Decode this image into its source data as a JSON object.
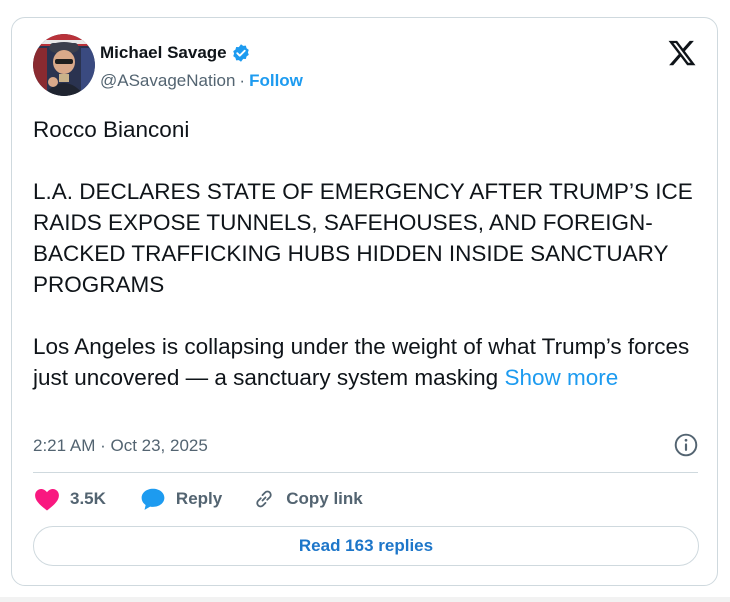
{
  "author": {
    "name": "Michael Savage",
    "handle": "@ASavageNation",
    "separator": "·",
    "follow_label": "Follow"
  },
  "tweet": {
    "body": "Rocco Bianconi\n\nL.A. DECLARES STATE OF EMERGENCY AFTER TRUMP’S ICE RAIDS EXPOSE TUNNELS, SAFEHOUSES, AND FOREIGN-BACKED TRAFFICKING HUBS HIDDEN INSIDE SANCTUARY PROGRAMS\n\nLos Angeles is collapsing under the weight of what Trump’s forces just uncovered — a sanctuary system masking ",
    "show_more_label": "Show more",
    "timestamp": "2:21 AM · Oct 23, 2025"
  },
  "actions": {
    "like_count": "3.5K",
    "reply_label": "Reply",
    "copy_link_label": "Copy link"
  },
  "read_replies_label": "Read 163 replies",
  "colors": {
    "accent": "#1d9bf0",
    "like": "#f91880",
    "verified": "#1d9bf0",
    "muted": "#536471"
  },
  "icons": {
    "verified": "verified-badge-icon",
    "brand": "x-logo-icon",
    "info": "info-icon",
    "like": "heart-icon",
    "reply": "speech-bubble-icon",
    "copy_link": "link-icon"
  }
}
